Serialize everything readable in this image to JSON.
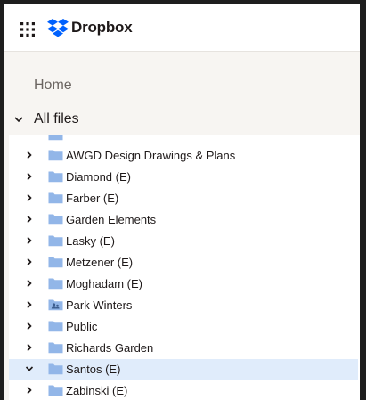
{
  "app": {
    "brand_name": "Dropbox",
    "brand_color": "#0061fe"
  },
  "topbar": {
    "apps_icon": "grid-icon",
    "logo_icon": "dropbox-logo-icon"
  },
  "sidebar": {
    "home_label": "Home",
    "all_files_label": "All files",
    "all_files_icon": "chevron-down-icon"
  },
  "tree": {
    "folder_color": "#92b6e8",
    "selected_color": "#e0ecfb",
    "items": [
      {
        "label": "AWGD Design Drawings & Plans",
        "expanded": false,
        "shared": false,
        "selected": false
      },
      {
        "label": "Diamond (E)",
        "expanded": false,
        "shared": false,
        "selected": false
      },
      {
        "label": "Farber (E)",
        "expanded": false,
        "shared": false,
        "selected": false
      },
      {
        "label": "Garden Elements",
        "expanded": false,
        "shared": false,
        "selected": false
      },
      {
        "label": "Lasky (E)",
        "expanded": false,
        "shared": false,
        "selected": false
      },
      {
        "label": "Metzener (E)",
        "expanded": false,
        "shared": false,
        "selected": false
      },
      {
        "label": "Moghadam (E)",
        "expanded": false,
        "shared": false,
        "selected": false
      },
      {
        "label": "Park Winters",
        "expanded": false,
        "shared": true,
        "selected": false
      },
      {
        "label": "Public",
        "expanded": false,
        "shared": false,
        "selected": false
      },
      {
        "label": "Richards Garden",
        "expanded": false,
        "shared": false,
        "selected": false
      },
      {
        "label": "Santos (E)",
        "expanded": true,
        "shared": false,
        "selected": true
      },
      {
        "label": "Zabinski (E)",
        "expanded": false,
        "shared": false,
        "selected": false
      }
    ]
  }
}
